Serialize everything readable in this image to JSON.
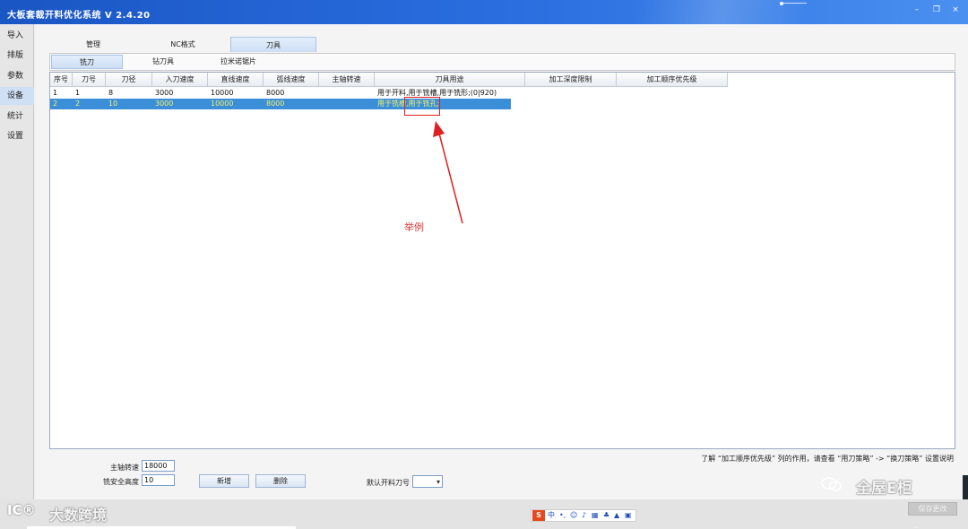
{
  "window": {
    "title": "大板套裁开料优化系统 V 2.4.20",
    "minimize_glyph": "–",
    "restore_glyph": "❐",
    "close_glyph": "×"
  },
  "sidebar": {
    "items": [
      {
        "label": "导入"
      },
      {
        "label": "排版"
      },
      {
        "label": "参数"
      },
      {
        "label": "设备",
        "active": true
      },
      {
        "label": "统计"
      },
      {
        "label": "设置"
      }
    ]
  },
  "tabs": [
    {
      "label": "管理"
    },
    {
      "label": "NC格式"
    },
    {
      "label": "刀具",
      "active": true
    }
  ],
  "subtabs": [
    {
      "label": "铣刀",
      "active": true
    },
    {
      "label": "钻刀具"
    },
    {
      "label": "拉米诺锯片"
    }
  ],
  "table": {
    "columns": [
      "序号",
      "刀号",
      "刀径",
      "入刀速度",
      "直线速度",
      "弧线速度",
      "主轴转速",
      "刀具用途",
      "加工深度限制",
      "加工顺序优先级"
    ],
    "rows": [
      [
        "1",
        "1",
        "8",
        "3000",
        "10000",
        "8000",
        "",
        "用于开料,用于铣槽,用于铣形;(0|920)",
        "",
        ""
      ],
      [
        "2",
        "2",
        "10",
        "3000",
        "10000",
        "8000",
        "",
        "用于铣槽,用于铣孔;",
        "",
        ""
      ]
    ],
    "selected_row": 1
  },
  "annotation": {
    "label": "举例"
  },
  "footer": {
    "hint": "了解 “加工顺序优先级” 列的作用，请查看 “用刀策略” -> “换刀策略” 设置说明",
    "spindle_label": "主轴转速",
    "spindle_value": "18000",
    "safe_height_label": "铣安全高度",
    "safe_height_value": "10",
    "add_button": "新增",
    "delete_button": "删除",
    "default_tool_label": "默认开料刀号",
    "default_tool_value": "",
    "save_button": "保存更改"
  },
  "ime": {
    "logo": "S",
    "mode": "中"
  },
  "watermarks": {
    "right": "全屋E柜",
    "left": "大数跨境",
    "logo": "IC®"
  },
  "colors": {
    "titlebar": "#2b6fe0",
    "selection": "#3b8ed8",
    "selection_text": "#f6f26a",
    "annotation": "#e02020"
  }
}
